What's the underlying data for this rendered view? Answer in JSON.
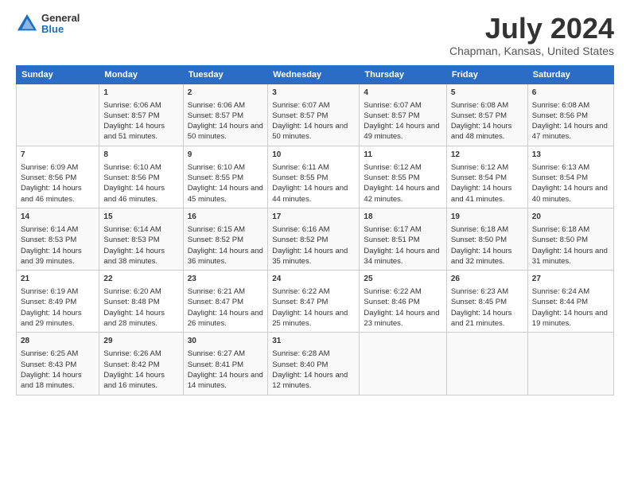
{
  "header": {
    "logo_general": "General",
    "logo_blue": "Blue",
    "title": "July 2024",
    "subtitle": "Chapman, Kansas, United States"
  },
  "columns": [
    "Sunday",
    "Monday",
    "Tuesday",
    "Wednesday",
    "Thursday",
    "Friday",
    "Saturday"
  ],
  "weeks": [
    [
      {
        "date": "",
        "sunrise": "",
        "sunset": "",
        "daylight": ""
      },
      {
        "date": "1",
        "sunrise": "Sunrise: 6:06 AM",
        "sunset": "Sunset: 8:57 PM",
        "daylight": "Daylight: 14 hours and 51 minutes."
      },
      {
        "date": "2",
        "sunrise": "Sunrise: 6:06 AM",
        "sunset": "Sunset: 8:57 PM",
        "daylight": "Daylight: 14 hours and 50 minutes."
      },
      {
        "date": "3",
        "sunrise": "Sunrise: 6:07 AM",
        "sunset": "Sunset: 8:57 PM",
        "daylight": "Daylight: 14 hours and 50 minutes."
      },
      {
        "date": "4",
        "sunrise": "Sunrise: 6:07 AM",
        "sunset": "Sunset: 8:57 PM",
        "daylight": "Daylight: 14 hours and 49 minutes."
      },
      {
        "date": "5",
        "sunrise": "Sunrise: 6:08 AM",
        "sunset": "Sunset: 8:57 PM",
        "daylight": "Daylight: 14 hours and 48 minutes."
      },
      {
        "date": "6",
        "sunrise": "Sunrise: 6:08 AM",
        "sunset": "Sunset: 8:56 PM",
        "daylight": "Daylight: 14 hours and 47 minutes."
      }
    ],
    [
      {
        "date": "7",
        "sunrise": "Sunrise: 6:09 AM",
        "sunset": "Sunset: 8:56 PM",
        "daylight": "Daylight: 14 hours and 46 minutes."
      },
      {
        "date": "8",
        "sunrise": "Sunrise: 6:10 AM",
        "sunset": "Sunset: 8:56 PM",
        "daylight": "Daylight: 14 hours and 46 minutes."
      },
      {
        "date": "9",
        "sunrise": "Sunrise: 6:10 AM",
        "sunset": "Sunset: 8:55 PM",
        "daylight": "Daylight: 14 hours and 45 minutes."
      },
      {
        "date": "10",
        "sunrise": "Sunrise: 6:11 AM",
        "sunset": "Sunset: 8:55 PM",
        "daylight": "Daylight: 14 hours and 44 minutes."
      },
      {
        "date": "11",
        "sunrise": "Sunrise: 6:12 AM",
        "sunset": "Sunset: 8:55 PM",
        "daylight": "Daylight: 14 hours and 42 minutes."
      },
      {
        "date": "12",
        "sunrise": "Sunrise: 6:12 AM",
        "sunset": "Sunset: 8:54 PM",
        "daylight": "Daylight: 14 hours and 41 minutes."
      },
      {
        "date": "13",
        "sunrise": "Sunrise: 6:13 AM",
        "sunset": "Sunset: 8:54 PM",
        "daylight": "Daylight: 14 hours and 40 minutes."
      }
    ],
    [
      {
        "date": "14",
        "sunrise": "Sunrise: 6:14 AM",
        "sunset": "Sunset: 8:53 PM",
        "daylight": "Daylight: 14 hours and 39 minutes."
      },
      {
        "date": "15",
        "sunrise": "Sunrise: 6:14 AM",
        "sunset": "Sunset: 8:53 PM",
        "daylight": "Daylight: 14 hours and 38 minutes."
      },
      {
        "date": "16",
        "sunrise": "Sunrise: 6:15 AM",
        "sunset": "Sunset: 8:52 PM",
        "daylight": "Daylight: 14 hours and 36 minutes."
      },
      {
        "date": "17",
        "sunrise": "Sunrise: 6:16 AM",
        "sunset": "Sunset: 8:52 PM",
        "daylight": "Daylight: 14 hours and 35 minutes."
      },
      {
        "date": "18",
        "sunrise": "Sunrise: 6:17 AM",
        "sunset": "Sunset: 8:51 PM",
        "daylight": "Daylight: 14 hours and 34 minutes."
      },
      {
        "date": "19",
        "sunrise": "Sunrise: 6:18 AM",
        "sunset": "Sunset: 8:50 PM",
        "daylight": "Daylight: 14 hours and 32 minutes."
      },
      {
        "date": "20",
        "sunrise": "Sunrise: 6:18 AM",
        "sunset": "Sunset: 8:50 PM",
        "daylight": "Daylight: 14 hours and 31 minutes."
      }
    ],
    [
      {
        "date": "21",
        "sunrise": "Sunrise: 6:19 AM",
        "sunset": "Sunset: 8:49 PM",
        "daylight": "Daylight: 14 hours and 29 minutes."
      },
      {
        "date": "22",
        "sunrise": "Sunrise: 6:20 AM",
        "sunset": "Sunset: 8:48 PM",
        "daylight": "Daylight: 14 hours and 28 minutes."
      },
      {
        "date": "23",
        "sunrise": "Sunrise: 6:21 AM",
        "sunset": "Sunset: 8:47 PM",
        "daylight": "Daylight: 14 hours and 26 minutes."
      },
      {
        "date": "24",
        "sunrise": "Sunrise: 6:22 AM",
        "sunset": "Sunset: 8:47 PM",
        "daylight": "Daylight: 14 hours and 25 minutes."
      },
      {
        "date": "25",
        "sunrise": "Sunrise: 6:22 AM",
        "sunset": "Sunset: 8:46 PM",
        "daylight": "Daylight: 14 hours and 23 minutes."
      },
      {
        "date": "26",
        "sunrise": "Sunrise: 6:23 AM",
        "sunset": "Sunset: 8:45 PM",
        "daylight": "Daylight: 14 hours and 21 minutes."
      },
      {
        "date": "27",
        "sunrise": "Sunrise: 6:24 AM",
        "sunset": "Sunset: 8:44 PM",
        "daylight": "Daylight: 14 hours and 19 minutes."
      }
    ],
    [
      {
        "date": "28",
        "sunrise": "Sunrise: 6:25 AM",
        "sunset": "Sunset: 8:43 PM",
        "daylight": "Daylight: 14 hours and 18 minutes."
      },
      {
        "date": "29",
        "sunrise": "Sunrise: 6:26 AM",
        "sunset": "Sunset: 8:42 PM",
        "daylight": "Daylight: 14 hours and 16 minutes."
      },
      {
        "date": "30",
        "sunrise": "Sunrise: 6:27 AM",
        "sunset": "Sunset: 8:41 PM",
        "daylight": "Daylight: 14 hours and 14 minutes."
      },
      {
        "date": "31",
        "sunrise": "Sunrise: 6:28 AM",
        "sunset": "Sunset: 8:40 PM",
        "daylight": "Daylight: 14 hours and 12 minutes."
      },
      {
        "date": "",
        "sunrise": "",
        "sunset": "",
        "daylight": ""
      },
      {
        "date": "",
        "sunrise": "",
        "sunset": "",
        "daylight": ""
      },
      {
        "date": "",
        "sunrise": "",
        "sunset": "",
        "daylight": ""
      }
    ]
  ]
}
